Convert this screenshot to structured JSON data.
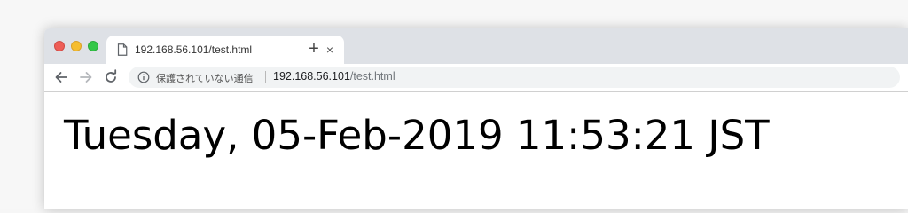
{
  "tab": {
    "title": "192.168.56.101/test.html",
    "close_glyph": "×",
    "icon": "document-icon"
  },
  "new_tab": {
    "glyph": "+"
  },
  "toolbar": {
    "back_icon": "arrow-left-icon",
    "forward_icon": "arrow-right-icon",
    "reload_icon": "reload-icon"
  },
  "omnibox": {
    "security_text": "保護されていない通信",
    "url_host": "192.168.56.101",
    "url_path": "/test.html",
    "icon": "info-icon"
  },
  "page": {
    "datetime": "Tuesday, 05-Feb-2019 11:53:21 JST"
  },
  "colors": {
    "tabstrip": "#dee1e6",
    "close": "#ee5e57",
    "minimize": "#f5bd2f",
    "maximize": "#33c748"
  }
}
